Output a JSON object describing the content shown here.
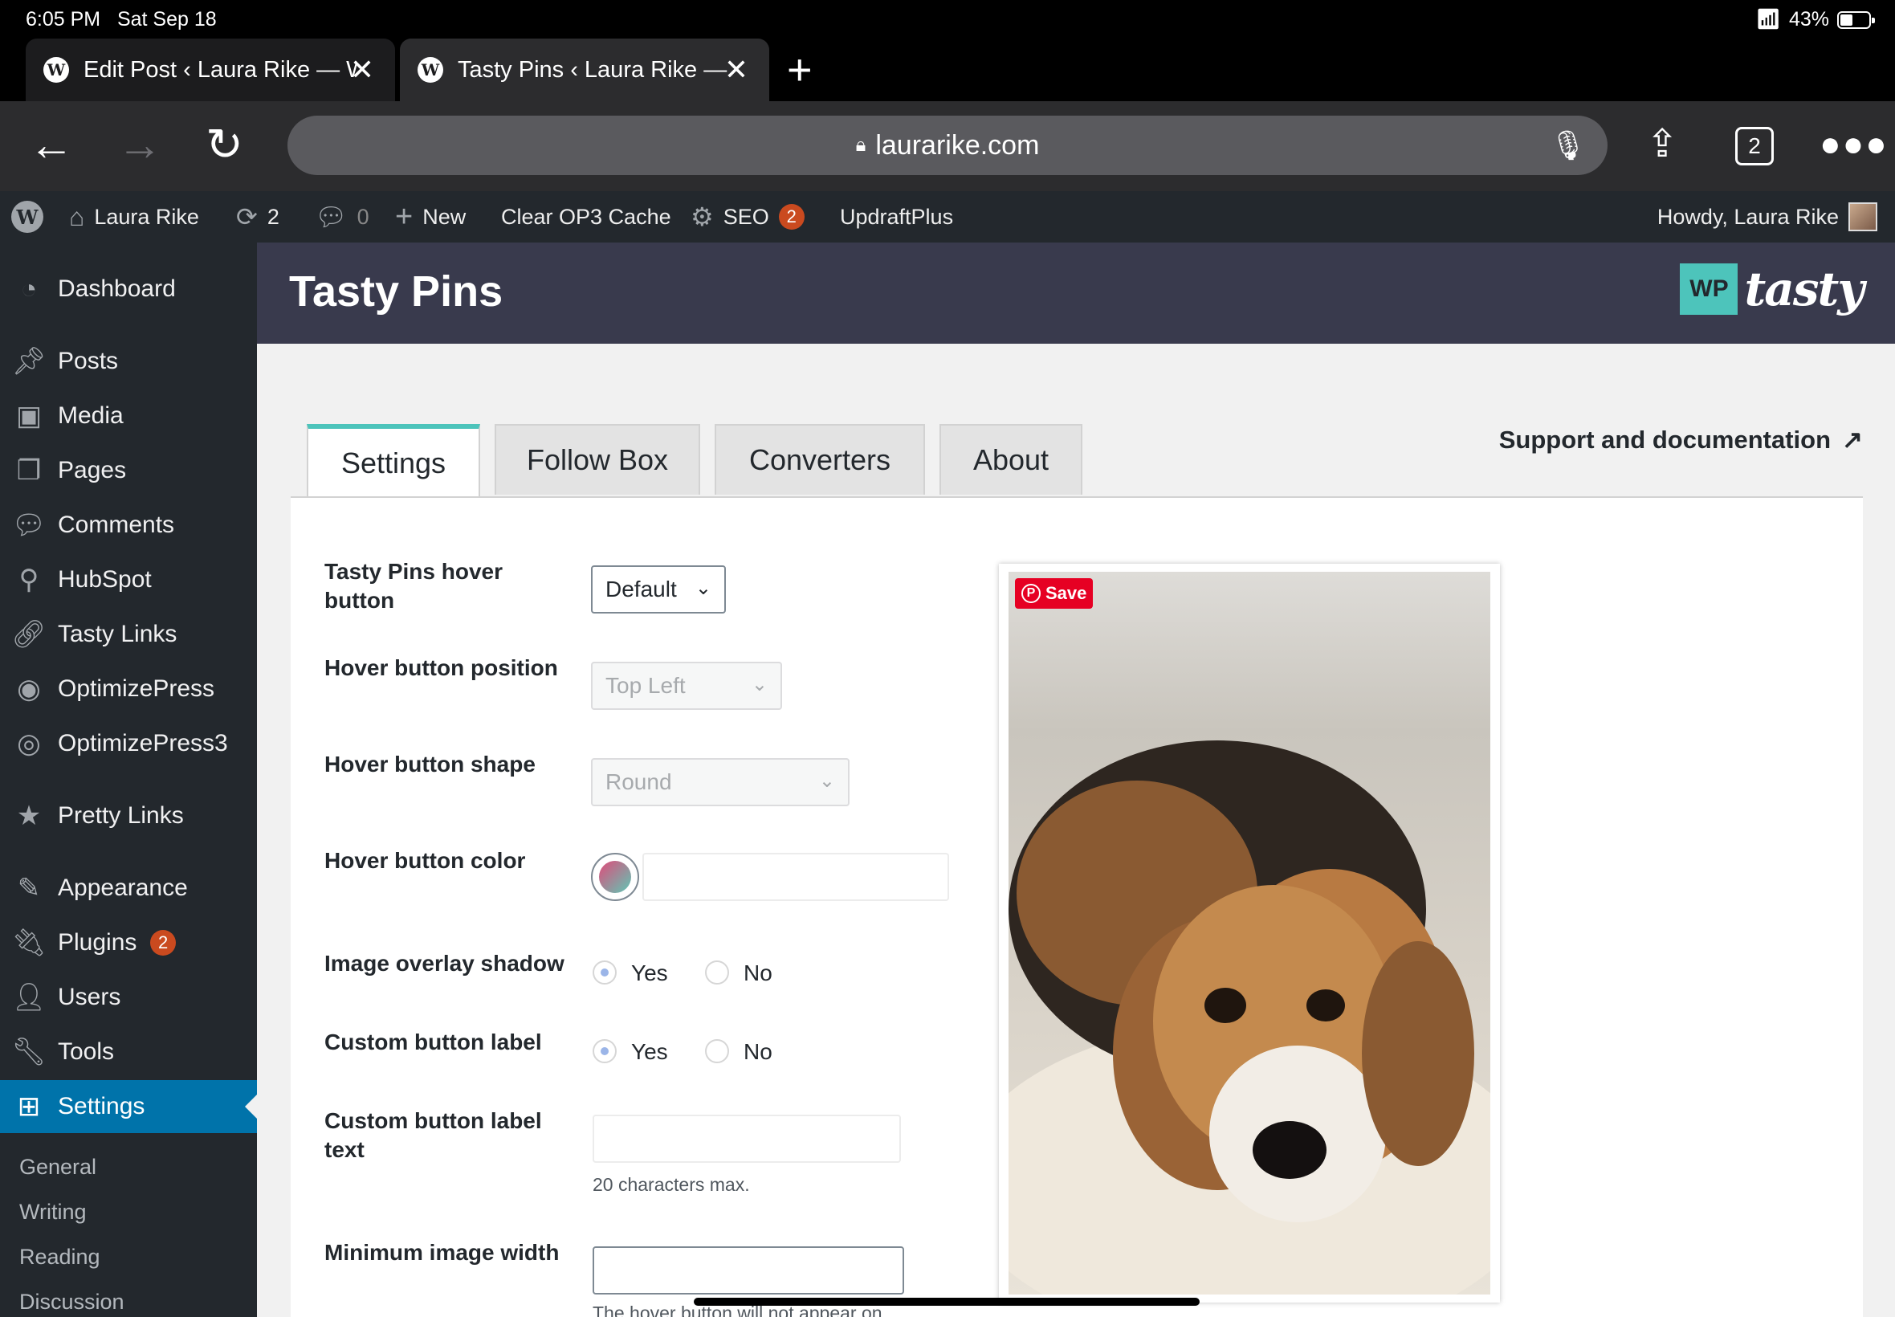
{
  "status_bar": {
    "time": "6:05 PM",
    "date": "Sat Sep 18",
    "battery": "43%",
    "battery_level": 0.43
  },
  "browser_tabs": [
    {
      "title": "Edit Post ‹ Laura Rike — W",
      "active": false
    },
    {
      "title": "Tasty Pins ‹ Laura Rike — W",
      "active": true
    }
  ],
  "address_bar": {
    "url": "laurarike.com",
    "tab_count": "2"
  },
  "admin_bar": {
    "site_name": "Laura Rike",
    "updates_count": "2",
    "comments_count": "0",
    "new_label": "New",
    "cache_label": "Clear OP3 Cache",
    "seo_label": "SEO",
    "seo_count": "2",
    "updraft_label": "UpdraftPlus",
    "howdy": "Howdy, Laura Rike"
  },
  "sidebar": {
    "items": [
      {
        "label": "Dashboard",
        "icon": "dashboard-icon"
      },
      {
        "label": "Posts",
        "icon": "pin-icon"
      },
      {
        "label": "Media",
        "icon": "media-icon"
      },
      {
        "label": "Pages",
        "icon": "pages-icon"
      },
      {
        "label": "Comments",
        "icon": "comment-icon"
      },
      {
        "label": "HubSpot",
        "icon": "hubspot-icon"
      },
      {
        "label": "Tasty Links",
        "icon": "link-icon"
      },
      {
        "label": "OptimizePress",
        "icon": "optimizepress-icon"
      },
      {
        "label": "OptimizePress3",
        "icon": "optimizepress3-icon"
      },
      {
        "label": "Pretty Links",
        "icon": "star-icon"
      },
      {
        "label": "Appearance",
        "icon": "brush-icon"
      },
      {
        "label": "Plugins",
        "icon": "plug-icon",
        "badge": "2"
      },
      {
        "label": "Users",
        "icon": "user-icon"
      },
      {
        "label": "Tools",
        "icon": "wrench-icon"
      },
      {
        "label": "Settings",
        "icon": "settings-icon"
      }
    ],
    "submenu": [
      "General",
      "Writing",
      "Reading",
      "Discussion"
    ]
  },
  "page": {
    "title": "Tasty Pins",
    "logo_wp": "WP",
    "logo_tasty": "tasty"
  },
  "tabs": [
    {
      "label": "Settings",
      "active": true
    },
    {
      "label": "Follow Box",
      "active": false
    },
    {
      "label": "Converters",
      "active": false
    },
    {
      "label": "About",
      "active": false
    }
  ],
  "support_link": "Support and documentation",
  "settings": {
    "hover_button": {
      "label": "Tasty Pins hover button",
      "value": "Default"
    },
    "position": {
      "label": "Hover button position",
      "value": "Top Left"
    },
    "shape": {
      "label": "Hover button shape",
      "value": "Round"
    },
    "color": {
      "label": "Hover button color"
    },
    "overlay_shadow": {
      "label": "Image overlay shadow",
      "yes": "Yes",
      "no": "No",
      "selected": "Yes"
    },
    "custom_label": {
      "label": "Custom button label",
      "yes": "Yes",
      "no": "No",
      "selected": "Yes"
    },
    "custom_label_text": {
      "label": "Custom button label text",
      "help": "20 characters max."
    },
    "min_width": {
      "label": "Minimum image width",
      "help": "The hover button will not appear on"
    }
  },
  "preview": {
    "save_label": "Save"
  },
  "colors": {
    "accent": "#4dc4bb",
    "wp_blue": "#0073aa",
    "admin_dark": "#23282d",
    "header": "#393a4d",
    "pinterest": "#e60023"
  }
}
